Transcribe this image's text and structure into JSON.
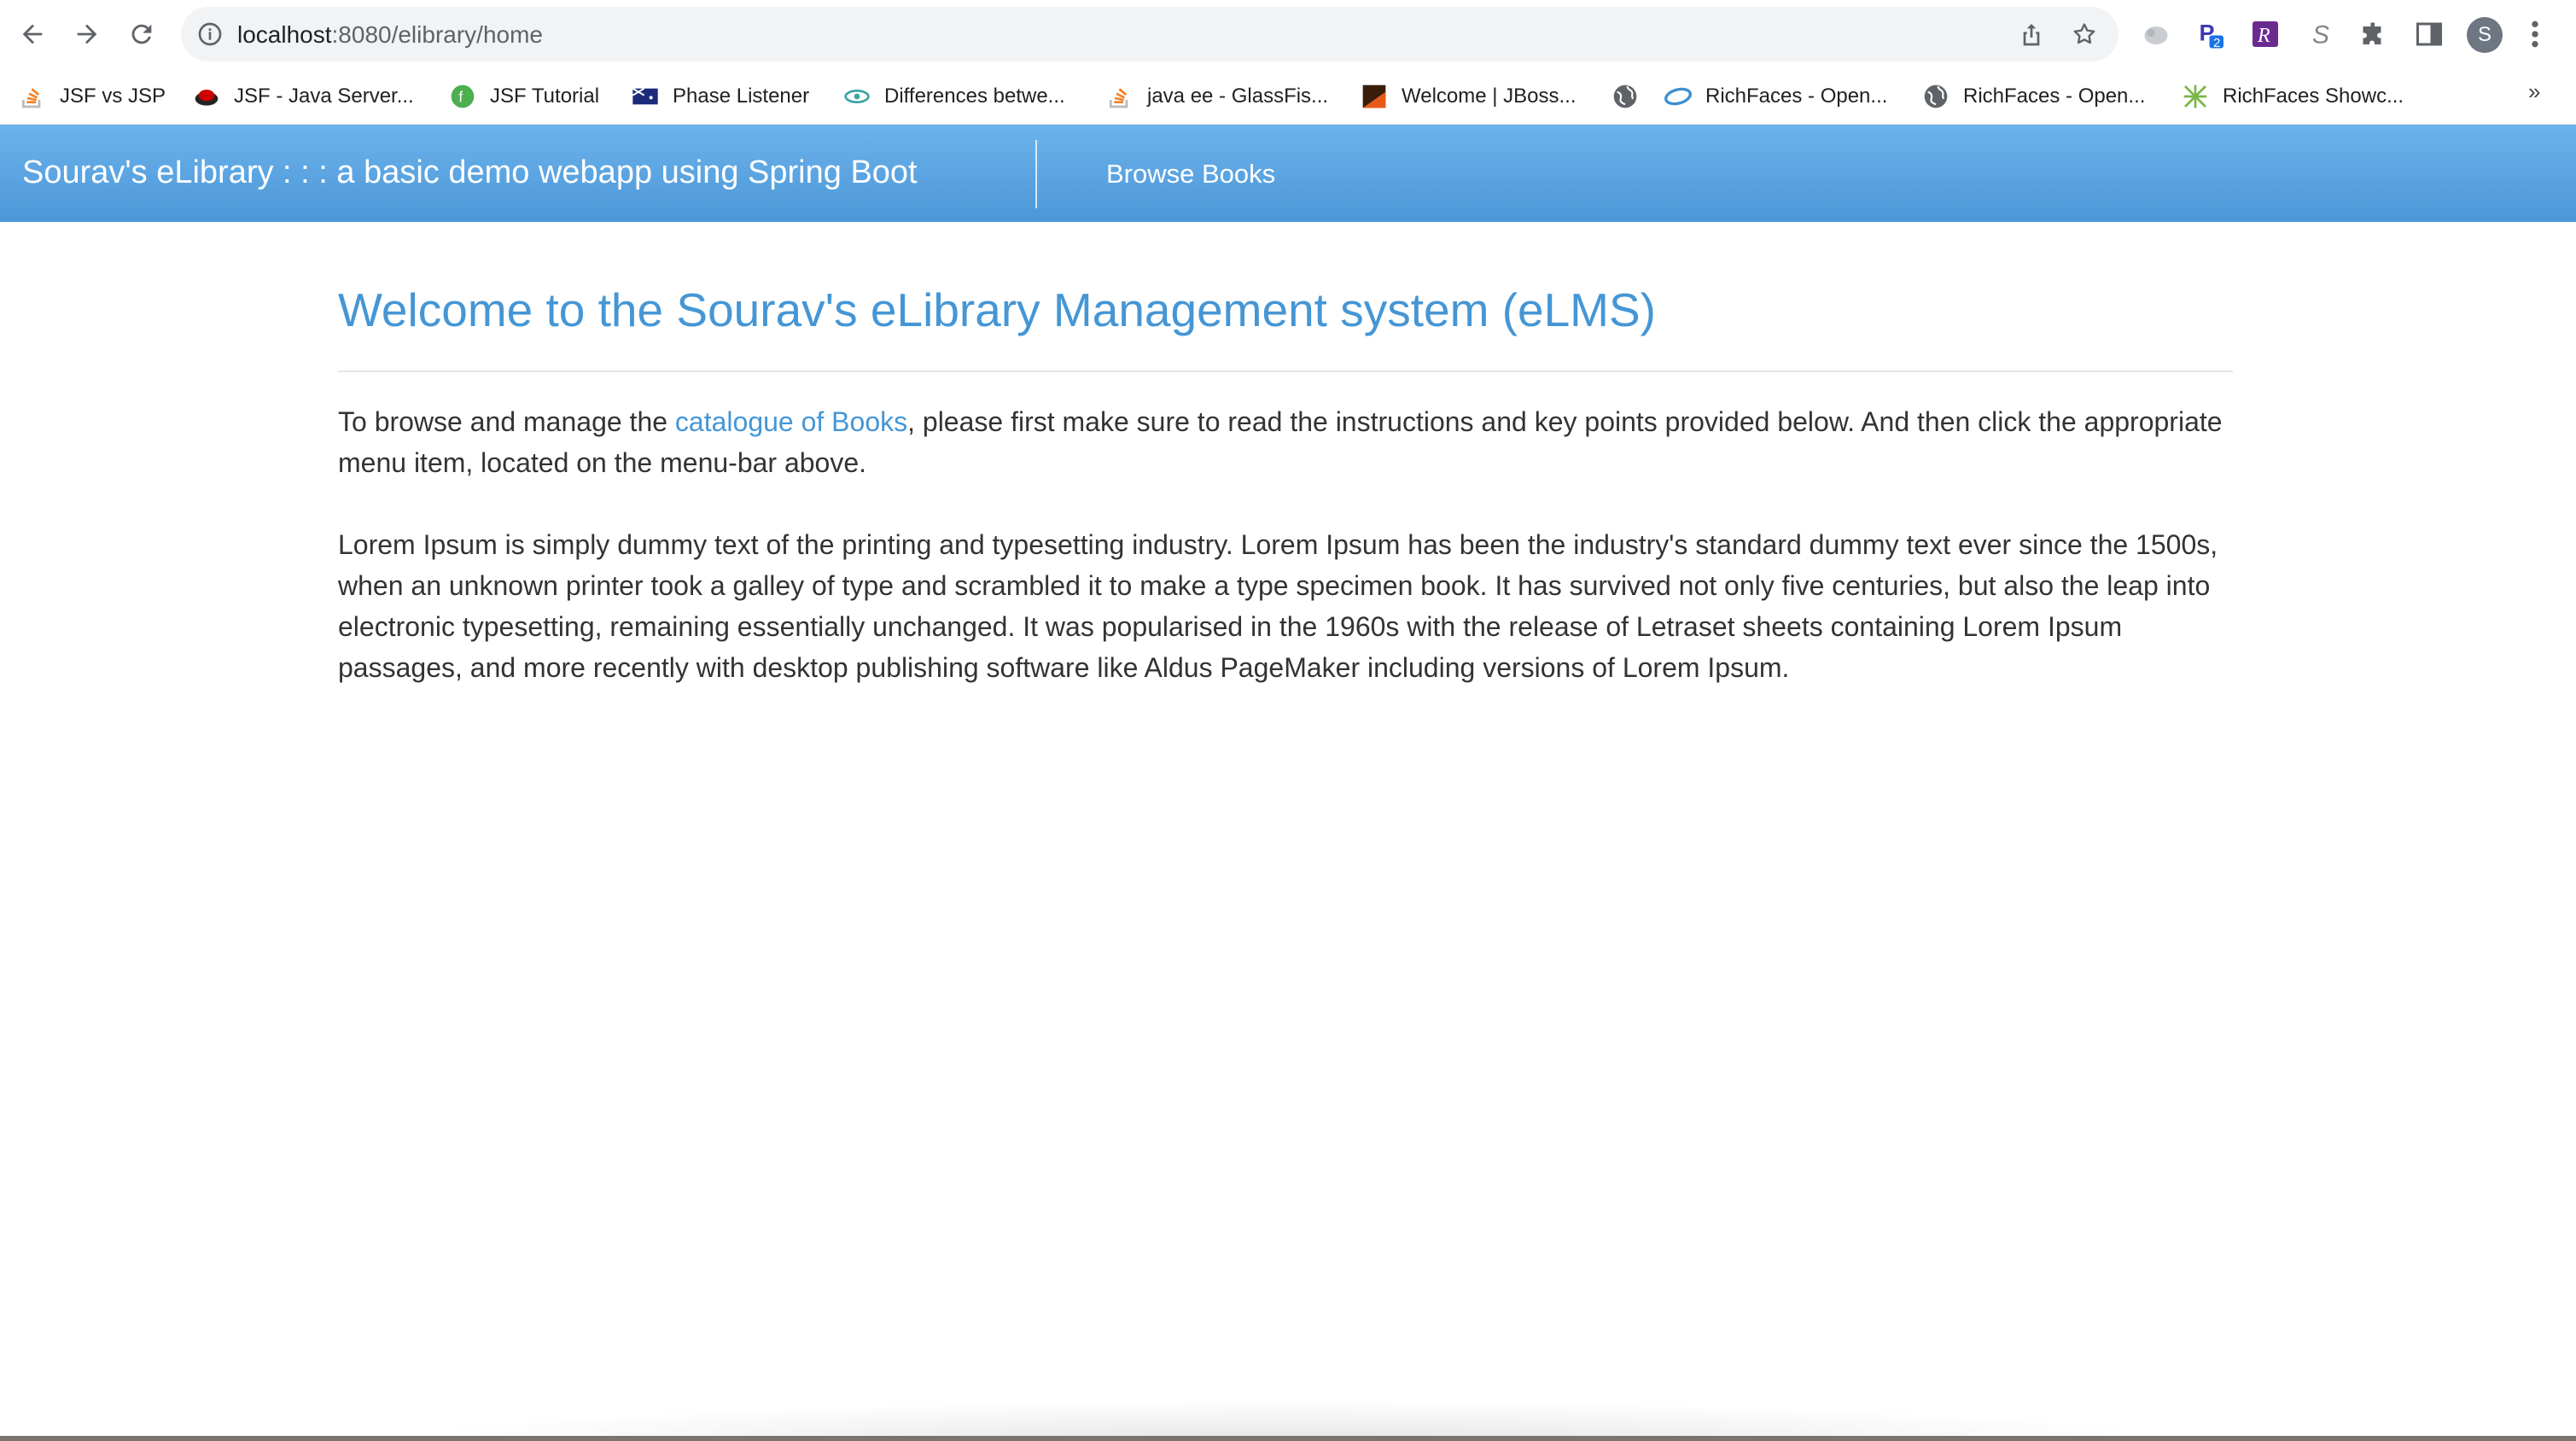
{
  "browser": {
    "url_host": "localhost",
    "url_path": ":8080/elibrary/home",
    "avatar_letter": "S",
    "extension_badge": "2",
    "bookmarks": [
      {
        "label": "JSF vs JSP",
        "icon": "stackoverflow-icon"
      },
      {
        "label": "JSF - Java Server...",
        "icon": "redhat-icon"
      },
      {
        "label": "JSF Tutorial",
        "icon": "green-leaf-icon"
      },
      {
        "label": "Phase Listener",
        "icon": "flag-icon"
      },
      {
        "label": "Differences betwe...",
        "icon": "eye-icon"
      },
      {
        "label": "java ee - GlassFis...",
        "icon": "stackoverflow-icon"
      },
      {
        "label": "Welcome | JBoss...",
        "icon": "jboss-icon"
      },
      {
        "label": "",
        "icon": "globe-icon"
      },
      {
        "label": "RichFaces - Open...",
        "icon": "richfaces-icon"
      },
      {
        "label": "RichFaces - Open...",
        "icon": "globe-icon"
      },
      {
        "label": "RichFaces Showc...",
        "icon": "richfaces-showcase-icon"
      }
    ],
    "more_label": "»"
  },
  "navbar": {
    "brand": "Sourav's eLibrary : : : a basic demo webapp using Spring Boot",
    "browse_label": "Browse Books"
  },
  "main": {
    "title": "Welcome to the Sourav's eLibrary Management system (eLMS)",
    "intro_before": "To browse and manage the ",
    "intro_link": "catalogue of Books",
    "intro_after": ", please first make sure to read the instructions and key points provided below. And then click the appropriate menu item, located on the menu-bar above.",
    "lorem": "Lorem Ipsum is simply dummy text of the printing and typesetting industry. Lorem Ipsum has been the industry's standard dummy text ever since the 1500s, when an unknown printer took a galley of type and scrambled it to make a type specimen book. It has survived not only five centuries, but also the leap into electronic typesetting, remaining essentially unchanged. It was popularised in the 1960s with the release of Letraset sheets containing Lorem Ipsum passages, and more recently with desktop publishing software like Aldus PageMaker including versions of Lorem Ipsum."
  },
  "colors": {
    "navbar_top": "#6cb3ec",
    "navbar_bottom": "#4c97d8",
    "accent": "#4596d5",
    "text": "#333333"
  }
}
